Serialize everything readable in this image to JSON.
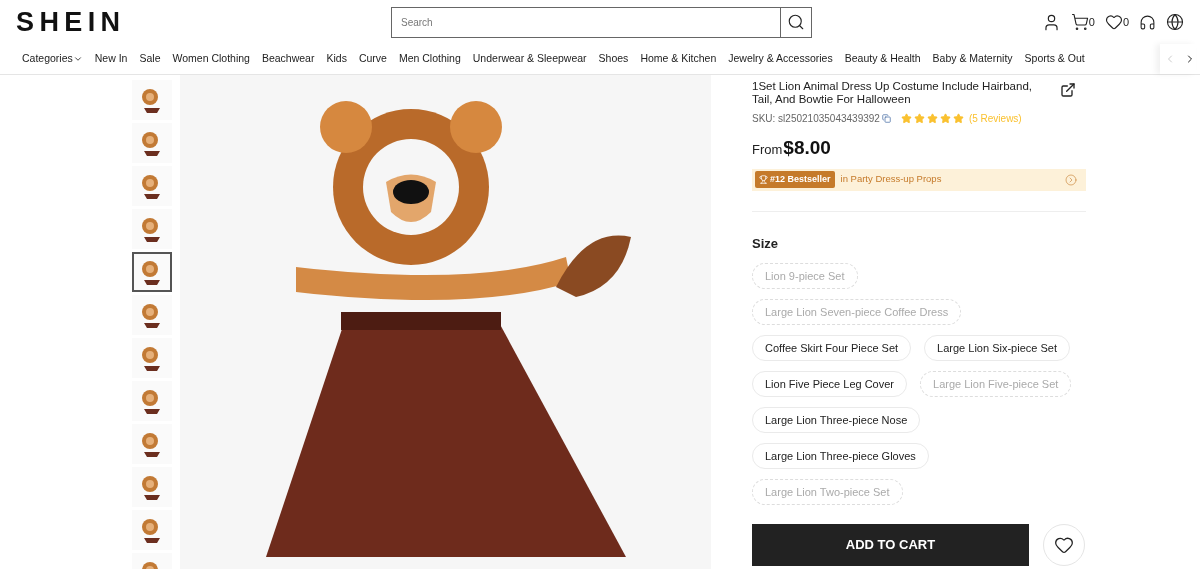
{
  "header": {
    "logo": "SHEIN",
    "search": {
      "placeholder": "Search"
    },
    "cart_count": "0",
    "wishlist_count": "0"
  },
  "nav": {
    "items": [
      "Categories",
      "New In",
      "Sale",
      "Women Clothing",
      "Beachwear",
      "Kids",
      "Curve",
      "Men Clothing",
      "Underwear & Sleepwear",
      "Shoes",
      "Home & Kitchen",
      "Jewelry & Accessories",
      "Beauty & Health",
      "Baby & Maternity",
      "Sports & Out"
    ]
  },
  "gallery": {
    "thumbnails": [
      {
        "selected": false
      },
      {
        "selected": false
      },
      {
        "selected": false
      },
      {
        "selected": false
      },
      {
        "selected": true
      },
      {
        "selected": false
      },
      {
        "selected": false
      },
      {
        "selected": false
      },
      {
        "selected": false
      },
      {
        "selected": false
      },
      {
        "selected": false
      },
      {
        "selected": false
      }
    ]
  },
  "product": {
    "title": "1Set Lion Animal Dress Up Costume Include Hairband, Tail, And Bowtie For Halloween",
    "sku": "SKU: sl25021035043439392",
    "stars": 5,
    "reviews": "(5 Reviews)",
    "price_prefix": "From",
    "price": "$8.00",
    "bestseller_badge": "#12 Bestseller",
    "bestseller_category": "in Party Dress-up Props"
  },
  "size": {
    "label": "Size",
    "options": [
      {
        "label": "Lion 9-piece Set",
        "available": false
      },
      {
        "label": "Large Lion Seven-piece Coffee Dress",
        "available": false
      },
      {
        "label": "Coffee Skirt Four Piece Set",
        "available": true
      },
      {
        "label": "Large Lion Six-piece Set",
        "available": true
      },
      {
        "label": "Lion Five Piece Leg Cover",
        "available": true
      },
      {
        "label": "Large Lion Five-piece Set",
        "available": false
      },
      {
        "label": "Large Lion Three-piece Nose",
        "available": true
      },
      {
        "label": "Large Lion Three-piece Gloves",
        "available": true
      },
      {
        "label": "Large Lion Two-piece Set",
        "available": false
      }
    ]
  },
  "add_to_cart": "ADD TO CART"
}
